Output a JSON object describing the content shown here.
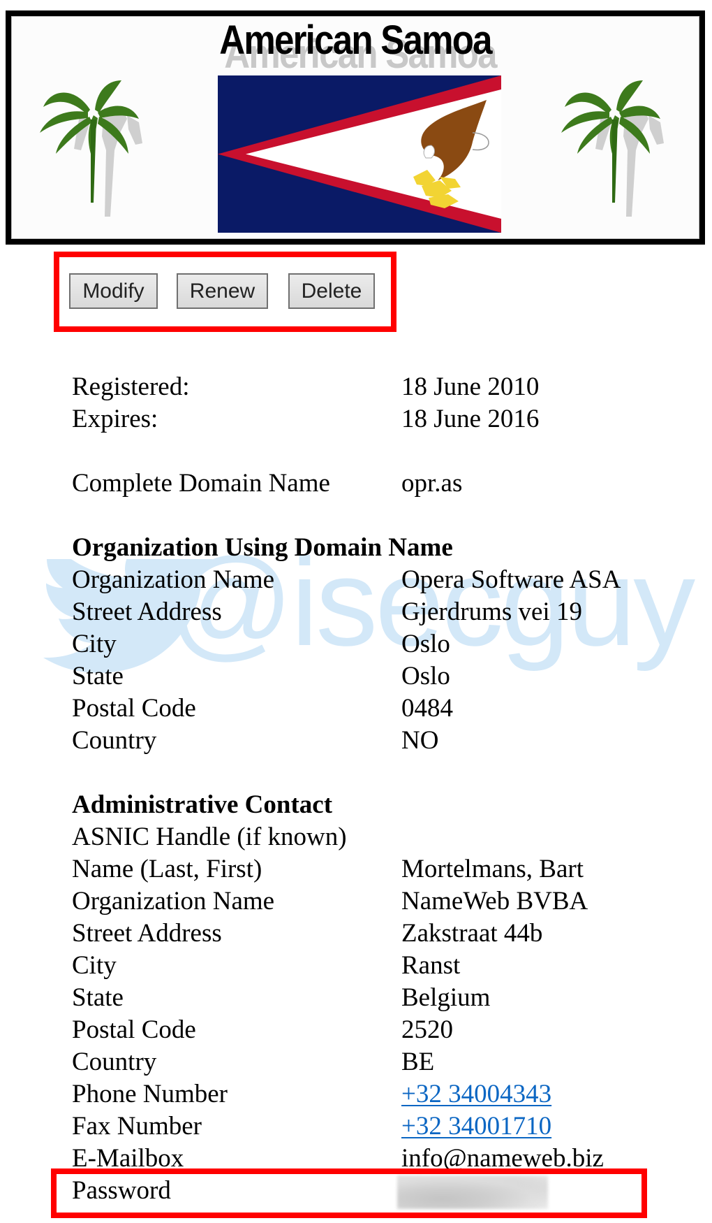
{
  "banner": {
    "title": "American Samoa",
    "flag_colors": {
      "blue": "#0a1a66",
      "red": "#c8102e",
      "white": "#ffffff",
      "eagle_brown": "#8a4a12",
      "eagle_yellow": "#f2d433"
    }
  },
  "actions": {
    "modify_label": "Modify",
    "renew_label": "Renew",
    "delete_label": "Delete"
  },
  "watermark": {
    "text": "@isecguy",
    "icon": "twitter-bird-icon",
    "color": "#d3e8f8"
  },
  "dates": {
    "registered_label": "Registered:",
    "registered_value": "18 June 2010",
    "expires_label": "Expires:",
    "expires_value": "18 June 2016"
  },
  "domain": {
    "label": "Complete Domain Name",
    "value": "opr.as"
  },
  "organization": {
    "heading": "Organization Using Domain Name",
    "rows": [
      {
        "label": "Organization Name",
        "value": "Opera Software ASA"
      },
      {
        "label": "Street Address",
        "value": "Gjerdrums vei 19"
      },
      {
        "label": "City",
        "value": "Oslo"
      },
      {
        "label": "State",
        "value": "Oslo"
      },
      {
        "label": "Postal Code",
        "value": "0484"
      },
      {
        "label": "Country",
        "value": "NO"
      }
    ]
  },
  "admin_contact": {
    "heading": "Administrative Contact",
    "rows": [
      {
        "label": "ASNIC Handle (if known)",
        "value": ""
      },
      {
        "label": "Name (Last, First)",
        "value": "Mortelmans, Bart"
      },
      {
        "label": "Organization Name",
        "value": "NameWeb BVBA"
      },
      {
        "label": "Street Address",
        "value": "Zakstraat 44b"
      },
      {
        "label": "City",
        "value": "Ranst"
      },
      {
        "label": "State",
        "value": "Belgium"
      },
      {
        "label": "Postal Code",
        "value": "2520"
      },
      {
        "label": "Country",
        "value": "BE"
      },
      {
        "label": "Phone Number",
        "value": "+32 34004343"
      },
      {
        "label": "Fax Number",
        "value": "+32 34001710"
      },
      {
        "label": "E-Mailbox",
        "value": "info@nameweb.biz"
      },
      {
        "label": "Password",
        "value": ""
      }
    ]
  },
  "colors": {
    "highlight_red": "#ff0000",
    "link_blue": "#0b66c3"
  }
}
